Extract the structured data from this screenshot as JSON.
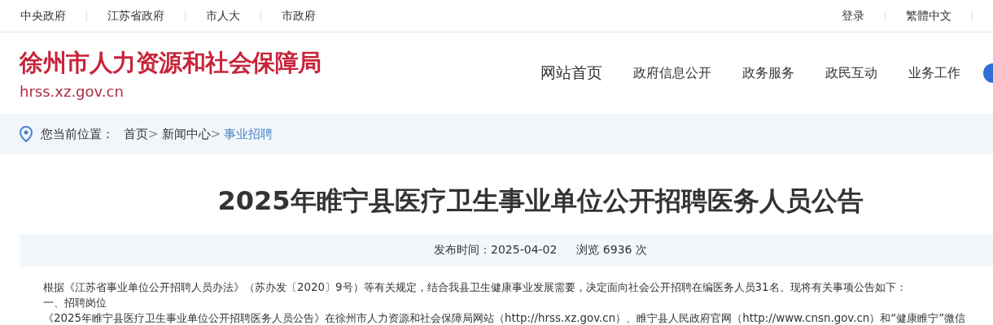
{
  "top_links": [
    "中央政府",
    "江苏省政府",
    "市人大",
    "市政府"
  ],
  "top_right": [
    "登录",
    "繁體中文"
  ],
  "site": {
    "name": "徐州市人力资源和社会保障局",
    "domain": "hrss.xz.gov.cn"
  },
  "nav": [
    {
      "label": "网站首页",
      "selected": true
    },
    {
      "label": "政府信息公开",
      "selected": false
    },
    {
      "label": "政务服务",
      "selected": false
    },
    {
      "label": "政民互动",
      "selected": false
    },
    {
      "label": "业务工作",
      "selected": false
    }
  ],
  "breadcrumb": {
    "label": "您当前位置：",
    "items": [
      {
        "label": "首页",
        "selected": false
      },
      {
        "label": "新闻中心",
        "selected": false
      },
      {
        "label": "事业招聘",
        "selected": true
      }
    ],
    "separator": ">"
  },
  "article": {
    "title": "2025年睢宁县医疗卫生事业单位公开招聘医务人员公告",
    "publish": "发布时间：2025-04-02",
    "views": "浏览 6936 次",
    "paragraphs": [
      "根据《江苏省事业单位公开招聘人员办法》（苏办发〔2020〕9号）等有关规定，结合我县卫生健康事业发展需要，决定面向社会公开招聘在编医务人员31名。现将有关事项公告如下：",
      "一、招聘岗位",
      "《2025年睢宁县医疗卫生事业单位公开招聘医务人员公告》在徐州市人力资源和社会保障局网站（http://hrss.xz.gov.cn）、睢宁县人民政府官网（http://www.cnsn.gov.cn）和“健康睢宁”微信"
    ]
  }
}
